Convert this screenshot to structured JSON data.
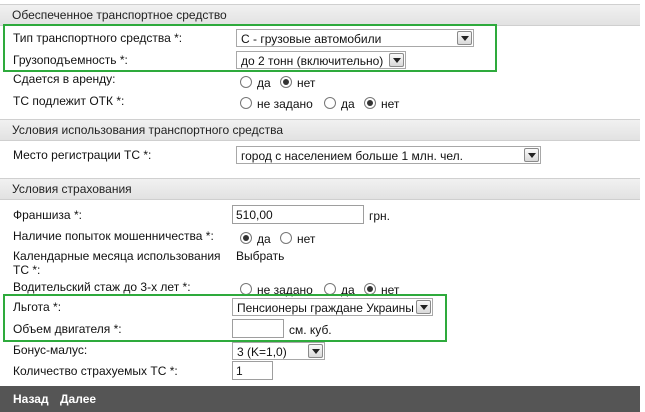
{
  "sections": {
    "vehicle": "Обеспеченное транспортное средство",
    "usage": "Условия использования транспортного средства",
    "insurance": "Условия страхования"
  },
  "fields": {
    "vehicle_type_label": "Тип транспортного средства *:",
    "vehicle_type_value": "С - грузовые автомобили",
    "capacity_label": "Грузоподъемность *:",
    "capacity_value": "до 2 тонн (включительно)",
    "rent_label": "Сдается в аренду:",
    "rent_yes": "да",
    "rent_no": "нет",
    "otk_label": "ТС подлежит ОТК *:",
    "otk_unset": "не задано",
    "otk_yes": "да",
    "otk_no": "нет",
    "reg_place_label": "Место регистрации ТС *:",
    "reg_place_value": "город с населением больше 1 млн. чел.",
    "franchise_label": "Франшиза *:",
    "franchise_value": "510,00",
    "franchise_unit": "грн.",
    "fraud_label": "Наличие попыток мошенничества *:",
    "fraud_yes": "да",
    "fraud_no": "нет",
    "calendar_label": "Календарные месяца использования ТС *:",
    "calendar_link": "Выбрать",
    "driver_exp_label": "Водительский стаж до 3-х лет *:",
    "driver_unset": "не задано",
    "driver_yes": "да",
    "driver_no": "нет",
    "benefit_label": "Льгота *:",
    "benefit_value": "Пенсионеры граждане Украины",
    "engine_label": "Объем двигателя *:",
    "engine_value": "",
    "engine_unit": "см. куб.",
    "bonus_label": "Бонус-малус:",
    "bonus_value": "3 (K=1,0)",
    "count_label": "Количество страхуемых ТС *:",
    "count_value": "1"
  },
  "footer": {
    "back": "Назад",
    "next": "Далее"
  },
  "colors": {
    "highlight": "#2eaa3c",
    "footer_bg": "#555555"
  }
}
